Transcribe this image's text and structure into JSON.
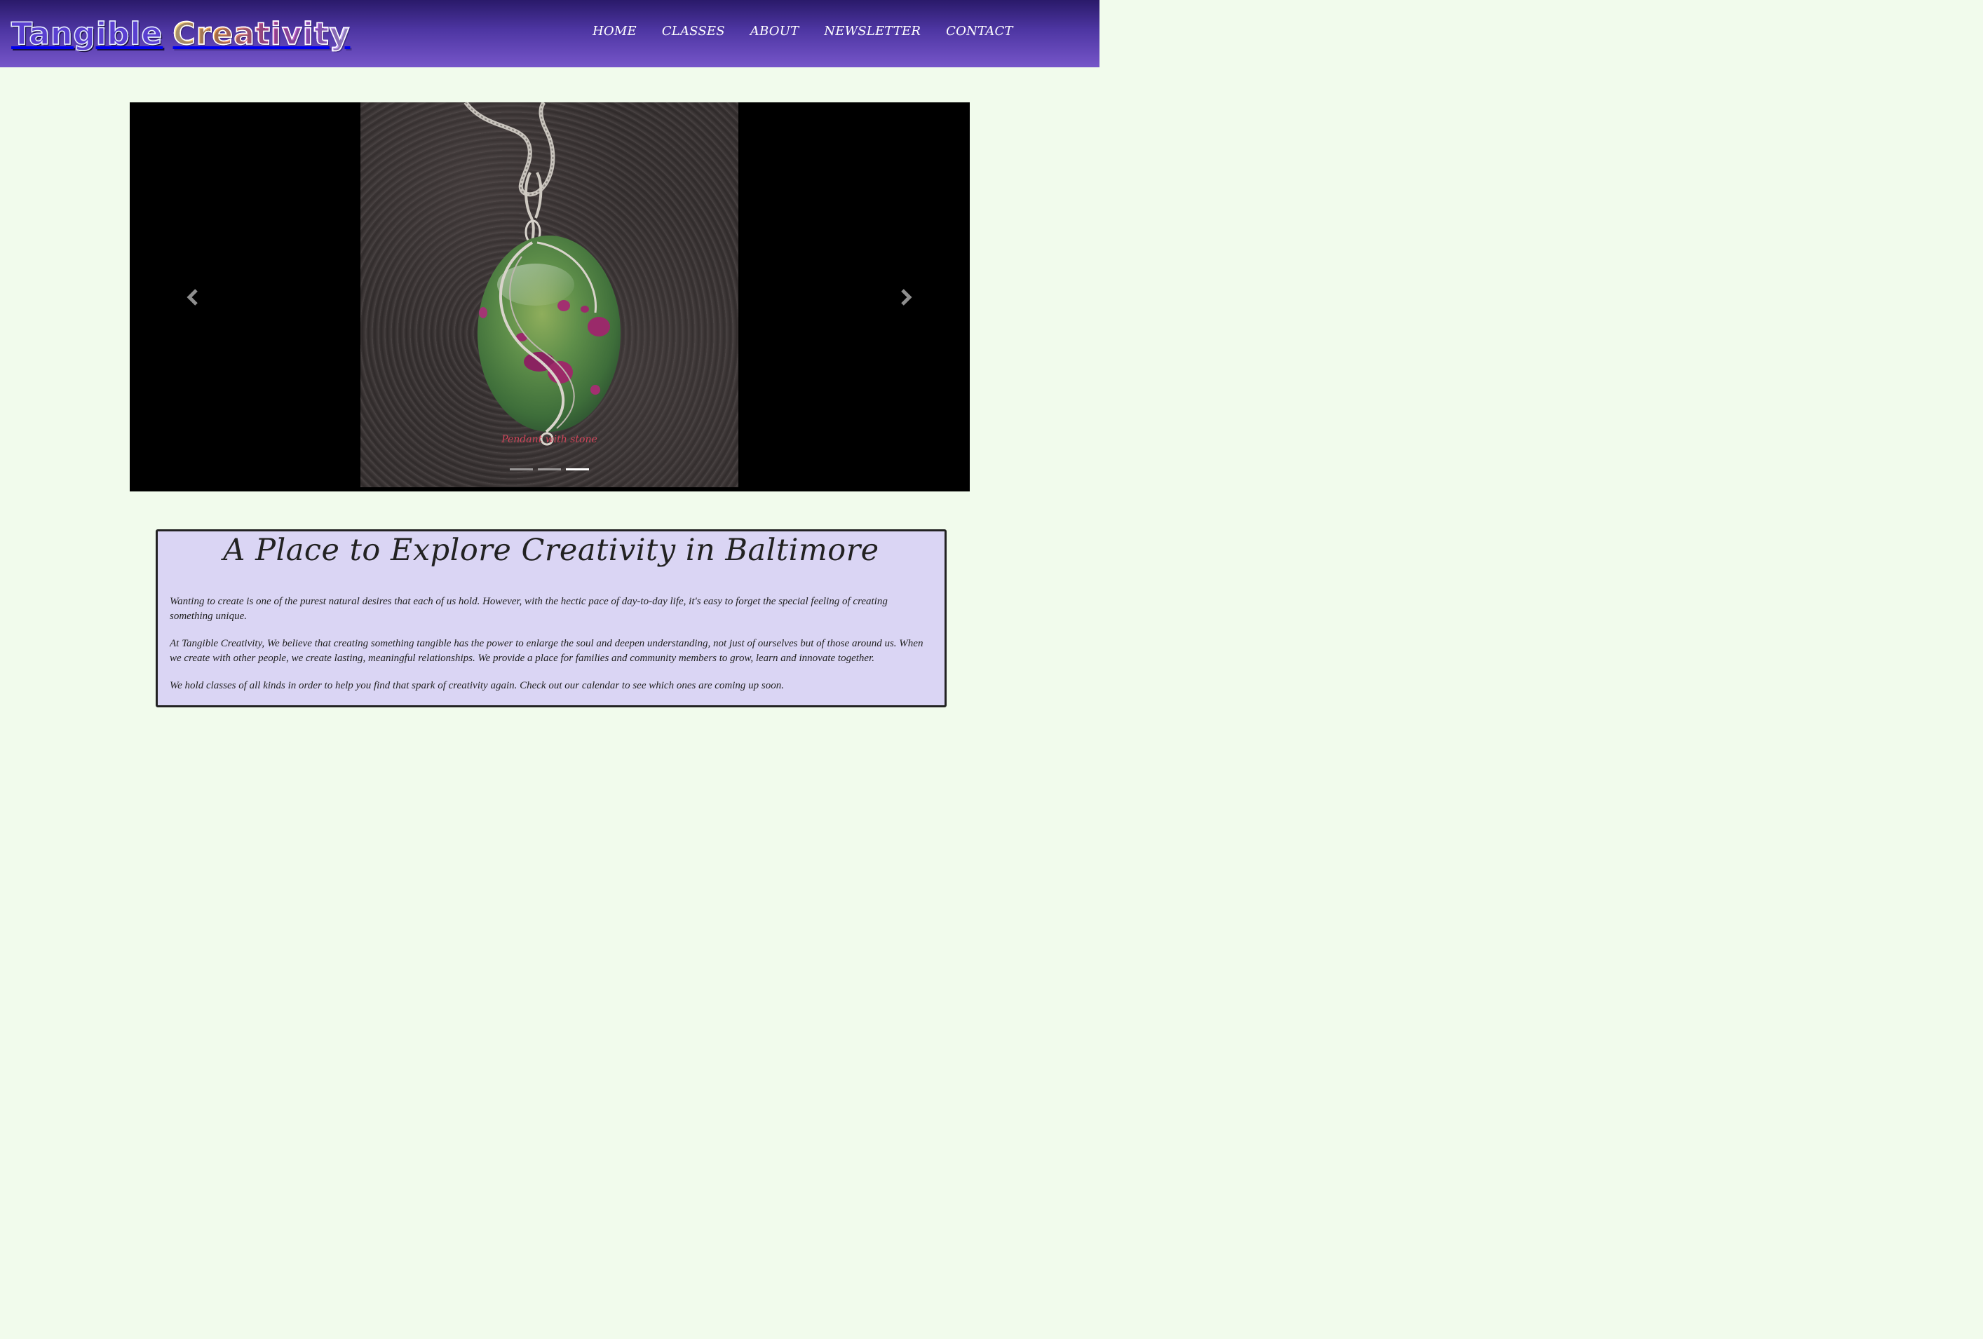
{
  "header": {
    "logo_word1": "Tangible",
    "logo_word2": "Creativity",
    "nav": [
      {
        "label": "HOME"
      },
      {
        "label": "CLASSES"
      },
      {
        "label": "ABOUT"
      },
      {
        "label": "NEWSLETTER"
      },
      {
        "label": "CONTACT"
      }
    ]
  },
  "carousel": {
    "caption": "Pendant with stone",
    "slide_count": 3,
    "active_index": 2,
    "prev_icon": "chevron-left-icon",
    "next_icon": "chevron-right-icon"
  },
  "intro": {
    "title": "A Place to Explore Creativity in Baltimore",
    "paragraphs": [
      "Wanting to create is one of the purest natural desires that each of us hold. However, with the hectic pace of day-to-day life, it's easy to forget the special feeling of creating something unique.",
      "At Tangible Creativity, We believe that creating something tangible has the power to enlarge the soul and deepen understanding, not just of ourselves but of those around us. When we create with other people, we create lasting, meaningful relationships. We provide a place for families and community members to grow, learn and innovate together.",
      "We hold classes of all kinds in order to help you find that spark of creativity again. Check out our calendar to see which ones are coming up soon."
    ]
  },
  "colors": {
    "header_top": "#2a1a6a",
    "header_bottom": "#7656c9",
    "page_background": "#f1fbec",
    "intro_background": "#dad5f4",
    "caption": "#d0455a"
  }
}
